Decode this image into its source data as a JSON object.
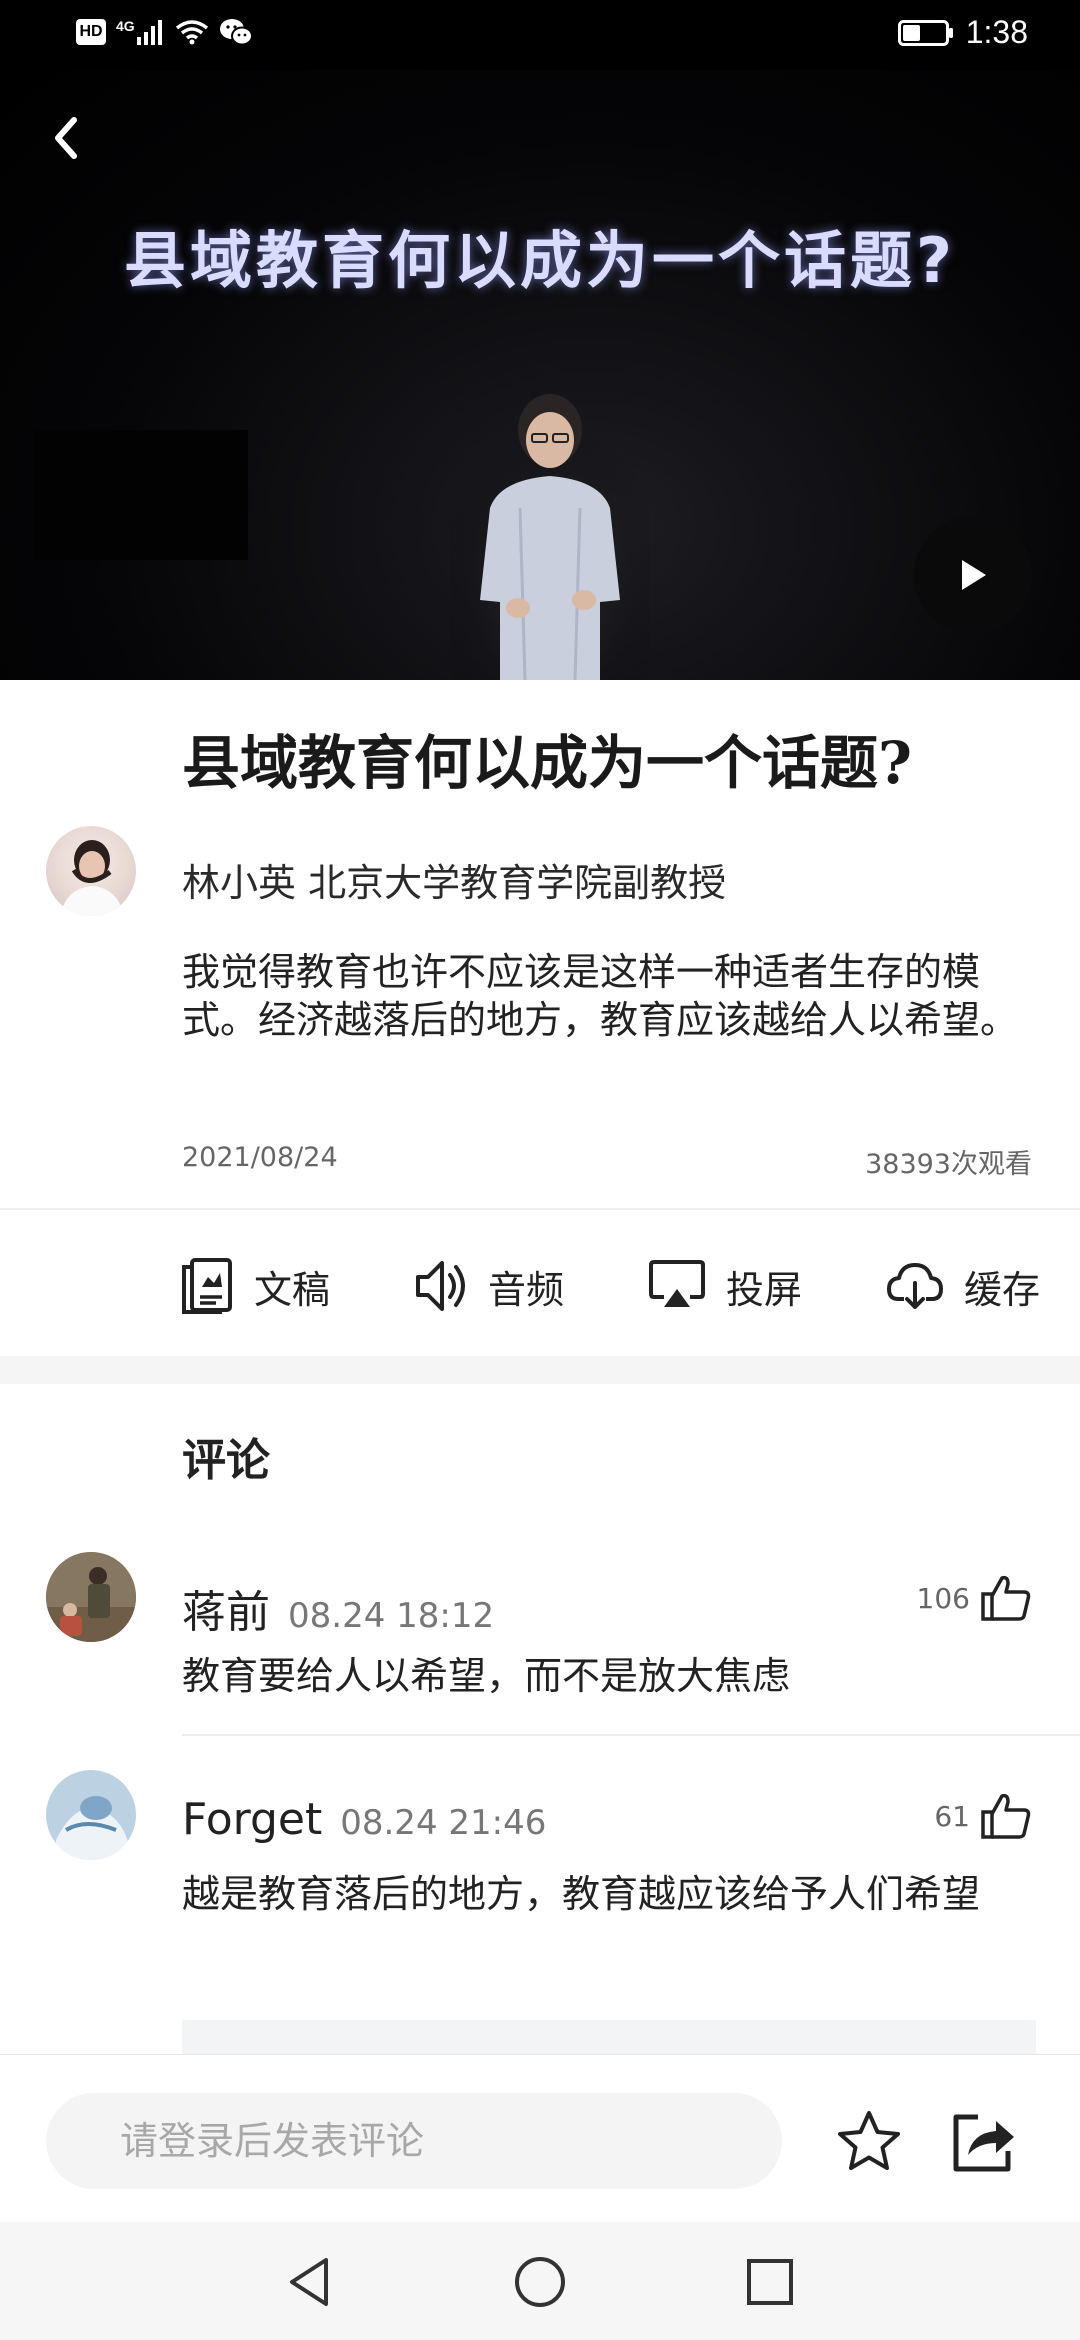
{
  "status_bar": {
    "hd_badge": "HD",
    "network_type": "4G",
    "battery_level": 0.4,
    "time": "1:38"
  },
  "video": {
    "title_overlay": "县域教育何以成为一个话题?"
  },
  "article": {
    "title": "县域教育何以成为一个话题?",
    "author": "林小英 北京大学教育学院副教授",
    "description": "我觉得教育也许不应该是这样一种适者生存的模式。经济越落后的地方，教育应该越给人以希望。",
    "date": "2021/08/24",
    "views": "38393次观看"
  },
  "actions": [
    {
      "label": "文稿",
      "icon": "document-icon"
    },
    {
      "label": "音频",
      "icon": "speaker-icon"
    },
    {
      "label": "投屏",
      "icon": "cast-icon"
    },
    {
      "label": "缓存",
      "icon": "cloud-download-icon"
    }
  ],
  "comments_section": {
    "title": "评论",
    "comments": [
      {
        "user": "蒋前",
        "time": "08.24 18:12",
        "likes": "106",
        "text": "教育要给人以希望，而不是放大焦虑"
      },
      {
        "user": "Forget",
        "time": "08.24 21:46",
        "likes": "61",
        "text": "越是教育落后的地方，教育越应该给予人们希望"
      }
    ]
  },
  "bottom_bar": {
    "input_placeholder": "请登录后发表评论"
  },
  "colors": {
    "status_bar_bg": "#000000",
    "video_title_glow": "#d9dcff",
    "text_primary": "#222222",
    "text_secondary": "#666666",
    "input_bg": "#f4f4f4"
  }
}
